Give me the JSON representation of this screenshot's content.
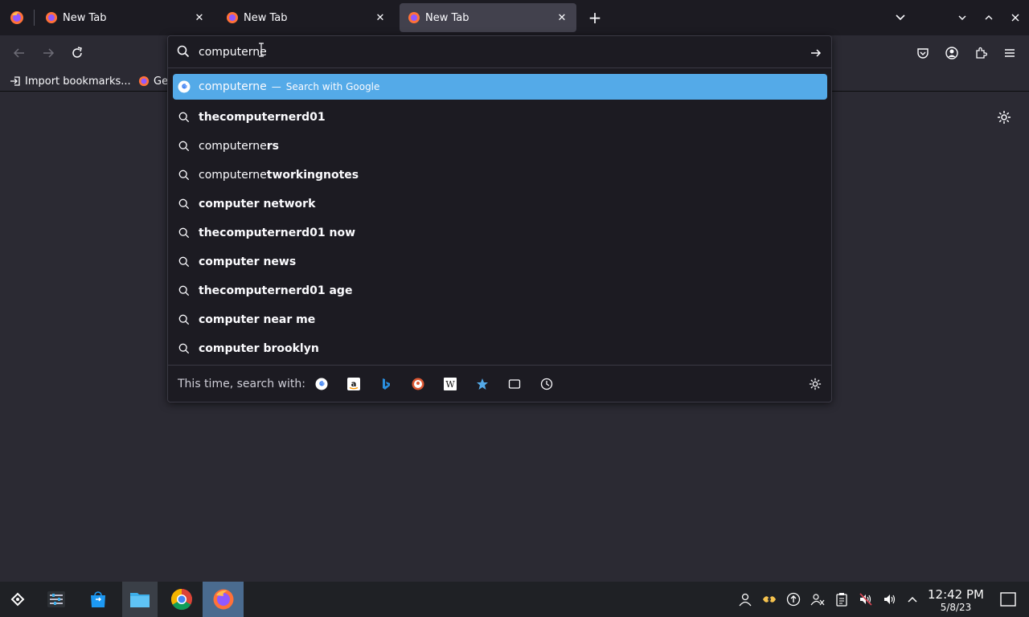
{
  "tabs": [
    {
      "title": "New Tab",
      "active": false
    },
    {
      "title": "New Tab",
      "active": false
    },
    {
      "title": "New Tab",
      "active": true
    }
  ],
  "bookmarks": {
    "import_label": "Import bookmarks...",
    "getting_started_label": "Ge"
  },
  "urlbar": {
    "value": "computerne"
  },
  "results": {
    "first": {
      "typed": "computerne",
      "sep": "—",
      "action": "Search with Google"
    },
    "suggestions": [
      {
        "prefix": "",
        "bold": "thecomputernerd01"
      },
      {
        "prefix": "computerne",
        "bold": "rs"
      },
      {
        "prefix": "computerne",
        "bold": "tworkingnotes"
      },
      {
        "prefix": "",
        "bold": "computer network"
      },
      {
        "prefix": "",
        "bold": "thecomputernerd01 now"
      },
      {
        "prefix": "",
        "bold": "computer news"
      },
      {
        "prefix": "",
        "bold": "thecomputernerd01 age"
      },
      {
        "prefix": "",
        "bold": "computer near me"
      },
      {
        "prefix": "",
        "bold": "computer brooklyn"
      }
    ]
  },
  "oneoff": {
    "label": "This time, search with:",
    "engines": [
      "google-icon",
      "amazon-icon",
      "bing-icon",
      "duckduckgo-icon",
      "wikipedia-icon",
      "bookmarks-icon",
      "tabs-icon",
      "history-icon"
    ]
  },
  "clock": {
    "time": "12:42 PM",
    "date": "5/8/23"
  },
  "colors": {
    "selected": "#54aae8",
    "popup_bg": "#1c1b22",
    "toolbar_bg": "#2b2a33",
    "taskbar_bg": "#1f2125"
  }
}
